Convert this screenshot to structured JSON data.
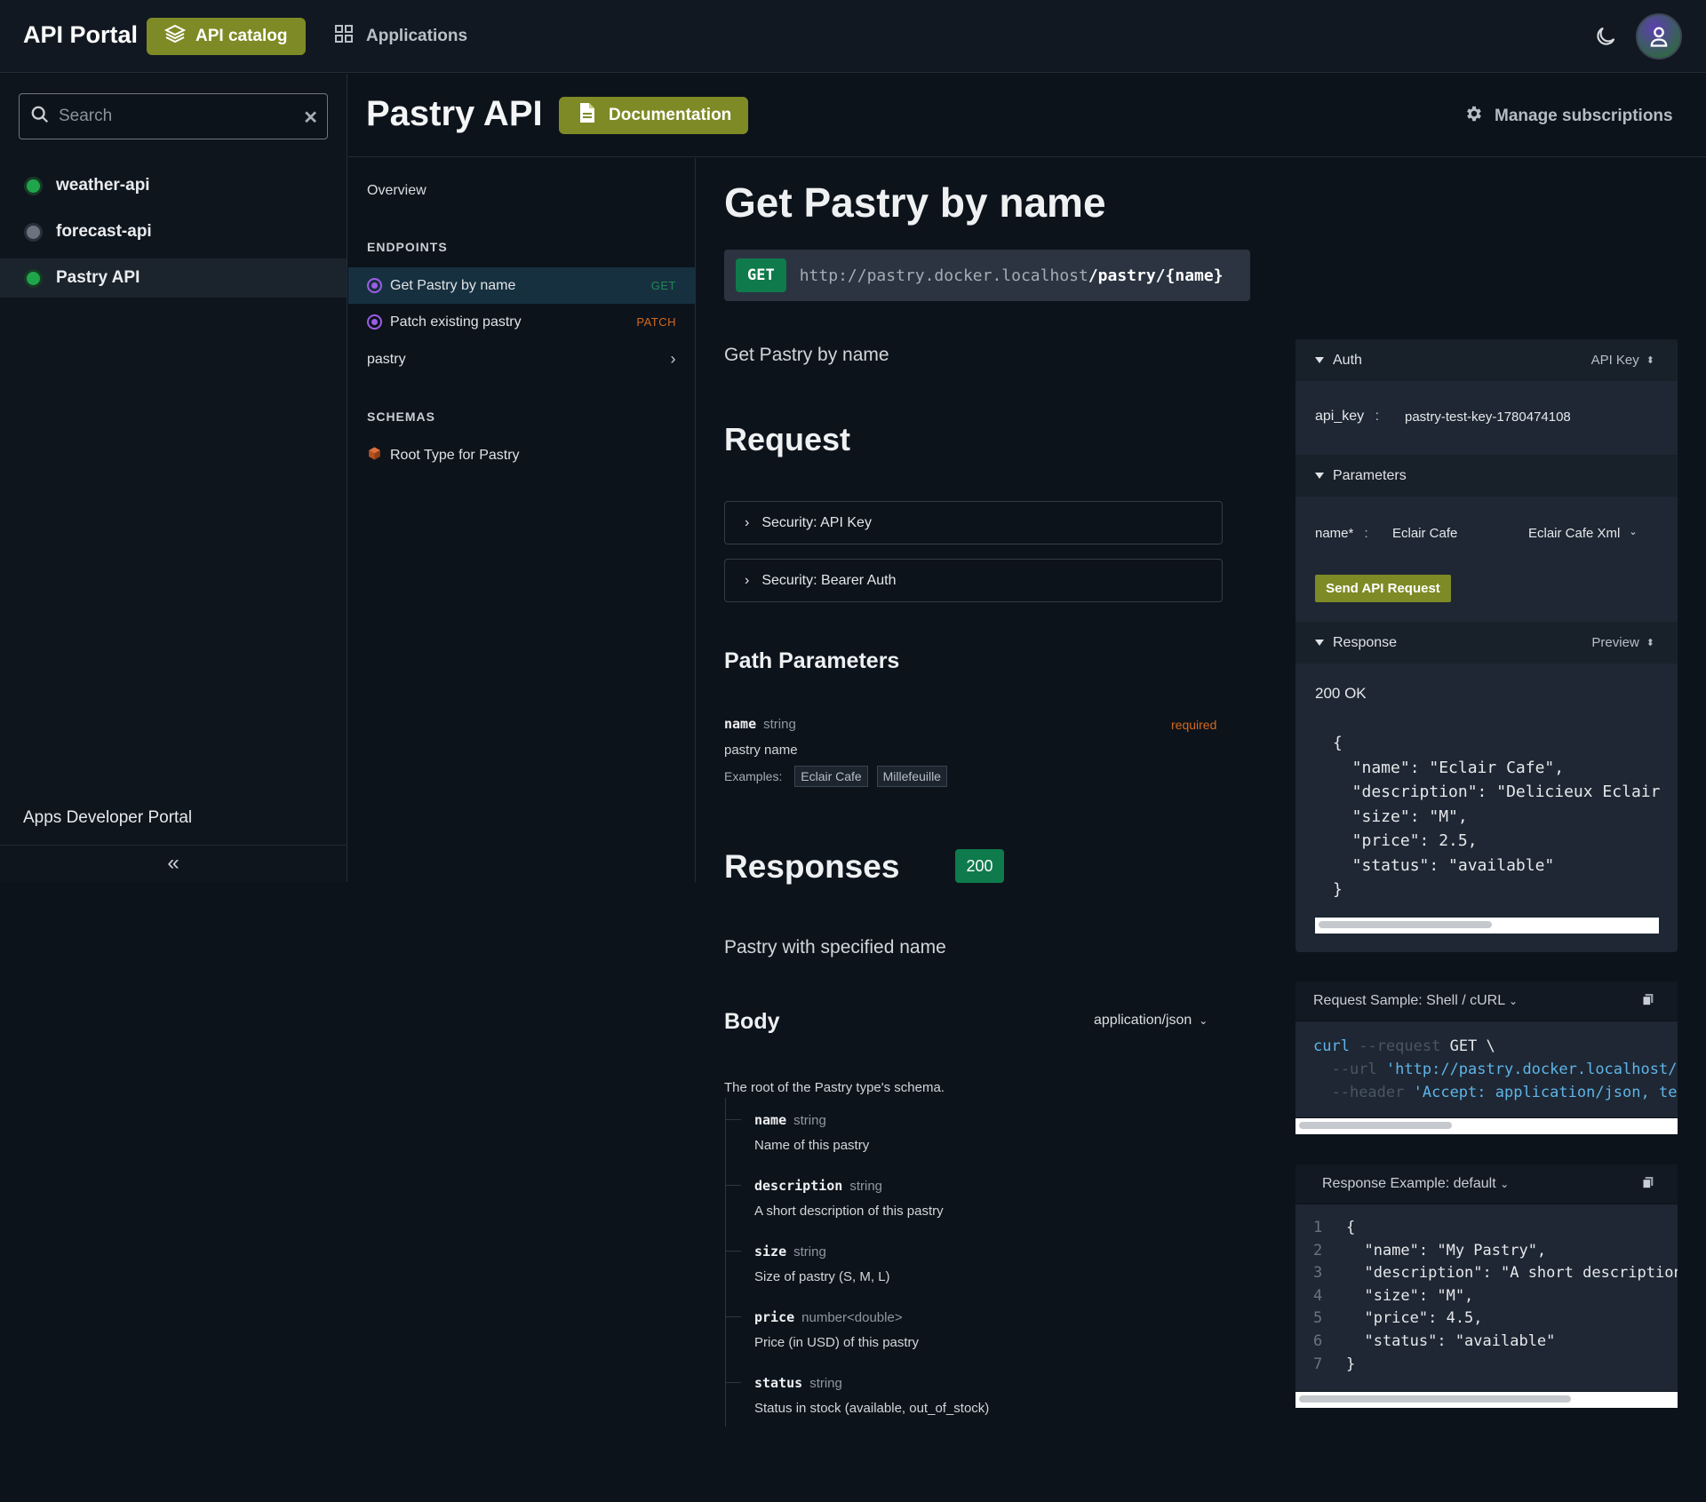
{
  "topbar": {
    "brand": "API Portal",
    "catalog_label": "API catalog",
    "apps_label": "Applications"
  },
  "sidebar": {
    "search_placeholder": "Search",
    "apis": [
      {
        "label": "weather-api",
        "status_color": "#1fa64a"
      },
      {
        "label": "forecast-api",
        "status_color": "#6b7380"
      },
      {
        "label": "Pastry API",
        "status_color": "#1fa64a"
      }
    ],
    "footer_label": "Apps Developer Portal"
  },
  "header": {
    "title": "Pastry API",
    "docs_label": "Documentation",
    "manage_label": "Manage subscriptions"
  },
  "nav": {
    "overview": "Overview",
    "endpoints_heading": "ENDPOINTS",
    "endpoints": [
      {
        "label": "Get Pastry by name",
        "method": "GET",
        "method_color": "#1d8a55"
      },
      {
        "label": "Patch existing pastry",
        "method": "PATCH",
        "method_color": "#d2691e"
      }
    ],
    "group": "pastry",
    "schemas_heading": "SCHEMAS",
    "schema_item": "Root Type for Pastry"
  },
  "main": {
    "title": "Get Pastry by name",
    "method": "GET",
    "url_base": "http://pastry.docker.localhost",
    "url_path": "/pastry/{name}",
    "summary": "Get Pastry by name",
    "request_heading": "Request",
    "security": [
      "Security: API Key",
      "Security: Bearer Auth"
    ],
    "path_params_heading": "Path Parameters",
    "param": {
      "name": "name",
      "type": "string",
      "required": "required",
      "description": "pastry name",
      "examples_label": "Examples:",
      "examples": [
        "Eclair Cafe",
        "Millefeuille"
      ]
    },
    "responses_heading": "Responses",
    "status_code": "200",
    "response_desc": "Pastry with specified name",
    "body_heading": "Body",
    "content_type": "application/json",
    "schema_desc": "The root of the Pastry type's schema.",
    "fields": [
      {
        "name": "name",
        "type": "string",
        "desc": "Name of this pastry"
      },
      {
        "name": "description",
        "type": "string",
        "desc": "A short description of this pastry"
      },
      {
        "name": "size",
        "type": "string",
        "desc": "Size of pastry (S, M, L)"
      },
      {
        "name": "price",
        "type": "number<double>",
        "desc": "Price (in USD) of this pastry"
      },
      {
        "name": "status",
        "type": "string",
        "desc": "Status in stock (available, out_of_stock)"
      }
    ]
  },
  "try_panel": {
    "auth_label": "Auth",
    "auth_type": "API Key",
    "api_key_label": "api_key",
    "api_key_value": "pastry-test-key-1780474108",
    "params_label": "Parameters",
    "param_label": "name*",
    "param_value": "Eclair Cafe",
    "param_example": "Eclair Cafe Xml",
    "send_label": "Send API Request",
    "response_label": "Response",
    "response_view": "Preview",
    "status_text": "200 OK",
    "response_lines": [
      "{",
      "  \"name\": \"Eclair Cafe\",",
      "  \"description\": \"Delicieux Eclair",
      "  \"size\": \"M\",",
      "  \"price\": 2.5,",
      "  \"status\": \"available\"",
      "}"
    ]
  },
  "request_sample": {
    "title": "Request Sample: Shell / cURL",
    "cmd": "curl",
    "flag_request": "--request",
    "method": "GET \\",
    "flag_url": "--url",
    "url": "'http://pastry.docker.localhost/",
    "flag_header": "--header",
    "header": "'Accept: application/json, te"
  },
  "response_example": {
    "title": "Response Example: default",
    "lines": [
      "{",
      "  \"name\": \"My Pastry\",",
      "  \"description\": \"A short description",
      "  \"size\": \"M\",",
      "  \"price\": 4.5,",
      "  \"status\": \"available\"",
      "}"
    ]
  }
}
